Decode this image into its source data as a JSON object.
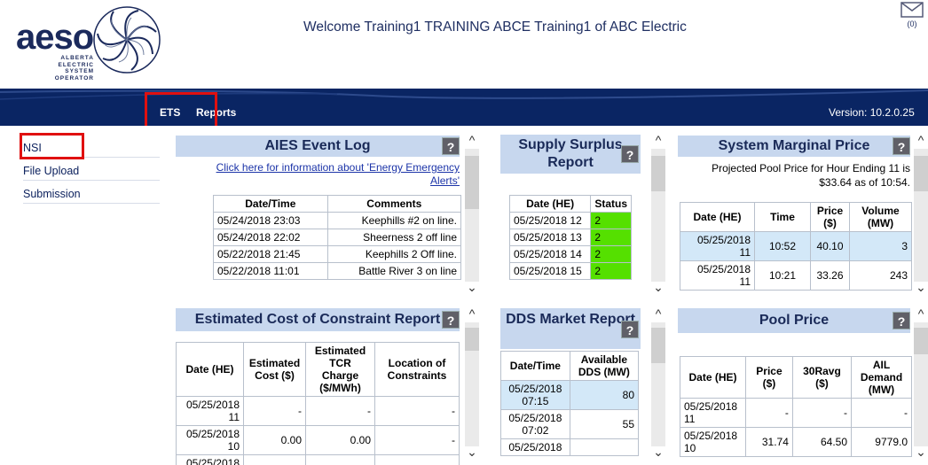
{
  "header": {
    "logo_text": "aeso",
    "logo_subtext": [
      "ALBERTA",
      "ELECTRIC",
      "SYSTEM",
      "OPERATOR"
    ],
    "welcome": "Welcome Training1 TRAINING ABCE Training1 of ABC Electric",
    "mail_count": "(0)"
  },
  "nav": {
    "ets": "ETS",
    "reports": "Reports",
    "version": "Version: 10.2.0.25"
  },
  "sidebar": {
    "items": [
      {
        "label": "NSI"
      },
      {
        "label": "File Upload"
      },
      {
        "label": "Submission"
      }
    ]
  },
  "event_log": {
    "title": "AIES Event Log",
    "link": "Click here for information about 'Energy Emergency Alerts'",
    "columns": [
      "Date/Time",
      "Comments"
    ],
    "rows": [
      [
        "05/24/2018 23:03",
        "Keephills #2 on line."
      ],
      [
        "05/24/2018 22:02",
        "Sheerness 2 off line"
      ],
      [
        "05/22/2018 21:45",
        "Keephills 2 Off line."
      ],
      [
        "05/22/2018 11:01",
        "Battle River 3 on line"
      ]
    ]
  },
  "supply_surplus": {
    "title": "Supply Surplus Report",
    "columns": [
      "Date (HE)",
      "Status"
    ],
    "rows": [
      [
        "05/25/2018 12",
        "2"
      ],
      [
        "05/25/2018 13",
        "2"
      ],
      [
        "05/25/2018 14",
        "2"
      ],
      [
        "05/25/2018 15",
        "2"
      ]
    ]
  },
  "smp": {
    "title": "System Marginal Price",
    "subtitle": "Projected Pool Price for Hour Ending 11 is $33.64 as of 10:54.",
    "columns": [
      "Date (HE)",
      "Time",
      "Price ($)",
      "Volume (MW)"
    ],
    "rows": [
      [
        "05/25/2018 11",
        "10:52",
        "40.10",
        "3"
      ],
      [
        "05/25/2018 11",
        "10:21",
        "33.26",
        "243"
      ]
    ]
  },
  "constraint": {
    "title": "Estimated Cost of Constraint Report",
    "columns": [
      "Date (HE)",
      "Estimated Cost ($)",
      "Estimated TCR Charge ($/MWh)",
      "Location of Constraints"
    ],
    "rows": [
      [
        "05/25/2018 11",
        "-",
        "-",
        "-"
      ],
      [
        "05/25/2018 10",
        "0.00",
        "0.00",
        "-"
      ],
      [
        "05/25/2018",
        "",
        "",
        ""
      ]
    ]
  },
  "dds": {
    "title": "DDS Market Report",
    "columns": [
      "Date/Time",
      "Available DDS (MW)"
    ],
    "rows": [
      [
        "05/25/2018 07:15",
        "80"
      ],
      [
        "05/25/2018 07:02",
        "55"
      ],
      [
        "05/25/2018",
        ""
      ]
    ]
  },
  "pool_price": {
    "title": "Pool Price",
    "columns": [
      "Date (HE)",
      "Price ($)",
      "30Ravg ($)",
      "AIL Demand (MW)"
    ],
    "rows": [
      [
        "05/25/2018 11",
        "-",
        "-",
        "-"
      ],
      [
        "05/25/2018 10",
        "31.74",
        "64.50",
        "9779.0"
      ]
    ]
  },
  "help_glyph": "?",
  "colors": {
    "navbar": "#0a2563",
    "title_bg": "#c7d7ee",
    "highlight_red": "#e01010",
    "status_green": "#55e000",
    "row_highlight": "#d3e8f8"
  }
}
